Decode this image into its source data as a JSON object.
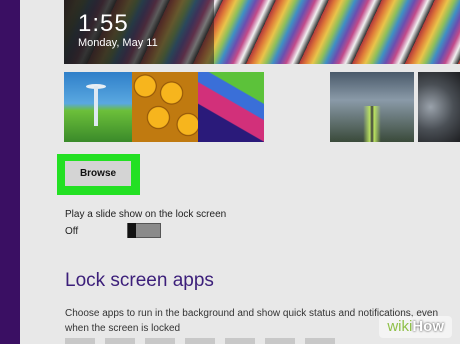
{
  "lock_preview": {
    "time": "1:55",
    "date": "Monday, May 11"
  },
  "background_thumbnails": [
    "seattle-landscape",
    "honeycomb",
    "abstract-shapes",
    "train-station",
    "dark-abstract"
  ],
  "browse_button": {
    "label": "Browse",
    "highlight_color": "#23e023"
  },
  "slideshow": {
    "label": "Play a slide show on the lock screen",
    "state": "Off"
  },
  "lock_screen_apps": {
    "title": "Lock screen apps",
    "description": "Choose apps to run in the background and show quick status and notifications, even when the screen is locked"
  },
  "watermark": {
    "wiki": "wiki",
    "how": "How"
  },
  "colors": {
    "accent": "#3c1f7a",
    "left_bar": "#3a0f63"
  }
}
